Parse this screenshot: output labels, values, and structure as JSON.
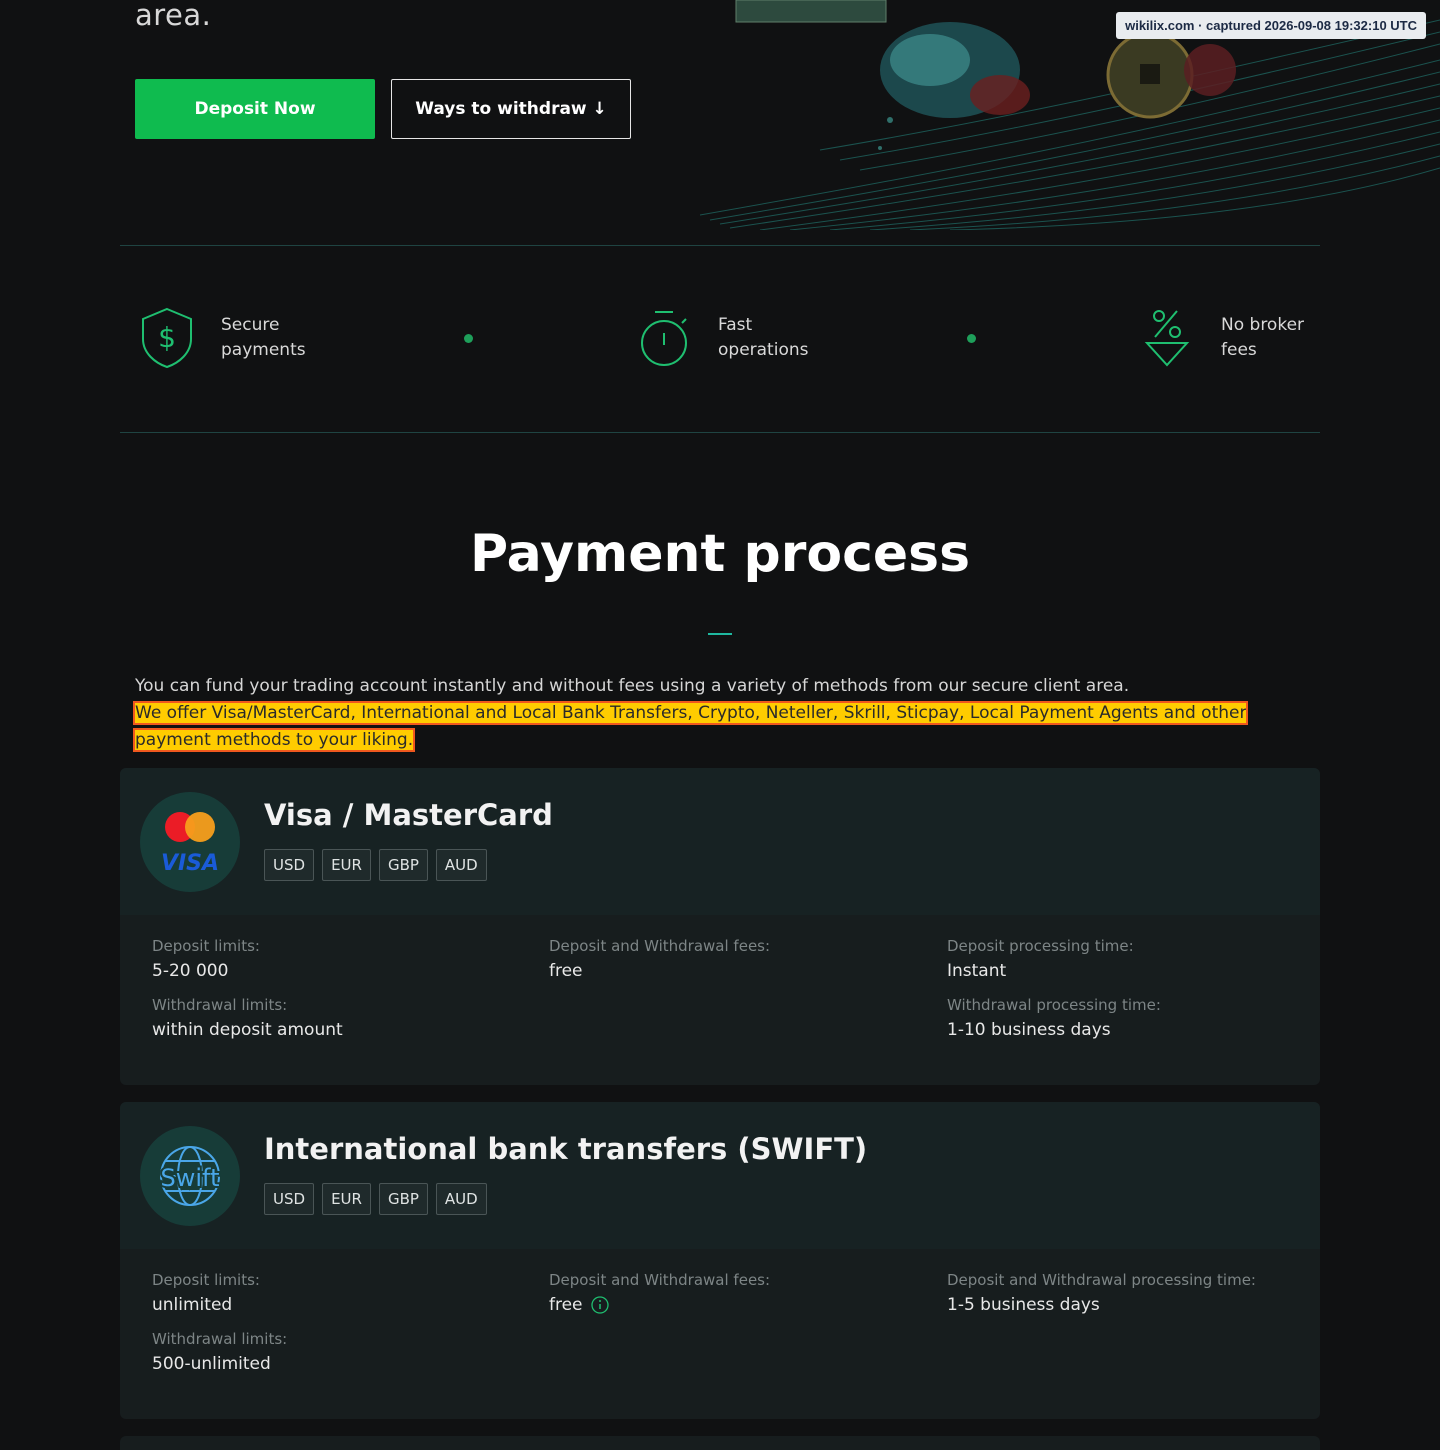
{
  "capture_badge": "wikilix.com · captured 2026-09-08 19:32:10 UTC",
  "hero": {
    "tail_text": "area.",
    "deposit_label": "Deposit Now",
    "withdraw_label": "Ways to withdraw ↓"
  },
  "features": [
    {
      "icon": "shield-dollar-icon",
      "line1": "Secure",
      "line2": "payments"
    },
    {
      "icon": "stopwatch-icon",
      "line1": "Fast",
      "line2": "operations"
    },
    {
      "icon": "percent-down-icon",
      "line1": "No broker",
      "line2": "fees"
    }
  ],
  "section": {
    "title": "Payment process",
    "intro_line1": "You can fund your trading account instantly and without fees using a variety of methods from our secure client area.",
    "intro_line2": "We offer Visa/MasterCard, International and Local Bank Transfers, Crypto, Neteller, Skrill, Sticpay, Local Payment Agents and other payment methods to your liking."
  },
  "colors": {
    "accent_green": "#0fbb4f",
    "teal": "#1fb8a0",
    "highlight": "#ffcc00",
    "highlight_border": "#f0581e"
  },
  "methods": [
    {
      "title": "Visa / MasterCard",
      "logo": "visa-mastercard-logo",
      "logo_text": "VISA",
      "currencies": [
        "USD",
        "EUR",
        "GBP",
        "AUD"
      ],
      "deposit_limits_label": "Deposit limits:",
      "deposit_limits": "5-20 000",
      "withdrawal_limits_label": "Withdrawal limits:",
      "withdrawal_limits": "within deposit amount",
      "fees_label": "Deposit and Withdrawal fees:",
      "fees": "free",
      "deposit_time_label": "Deposit processing time:",
      "deposit_time": "Instant",
      "withdrawal_time_label": "Withdrawal processing time:",
      "withdrawal_time": "1-10 business days"
    },
    {
      "title": "International bank transfers (SWIFT)",
      "logo": "swift-globe-logo",
      "logo_text": "Swift",
      "currencies": [
        "USD",
        "EUR",
        "GBP",
        "AUD"
      ],
      "deposit_limits_label": "Deposit limits:",
      "deposit_limits": "unlimited",
      "withdrawal_limits_label": "Withdrawal limits:",
      "withdrawal_limits": "500-unlimited",
      "fees_label": "Deposit and Withdrawal fees:",
      "fees": "free",
      "time_label": "Deposit and Withdrawal processing time:",
      "time": "1-5 business days"
    }
  ]
}
